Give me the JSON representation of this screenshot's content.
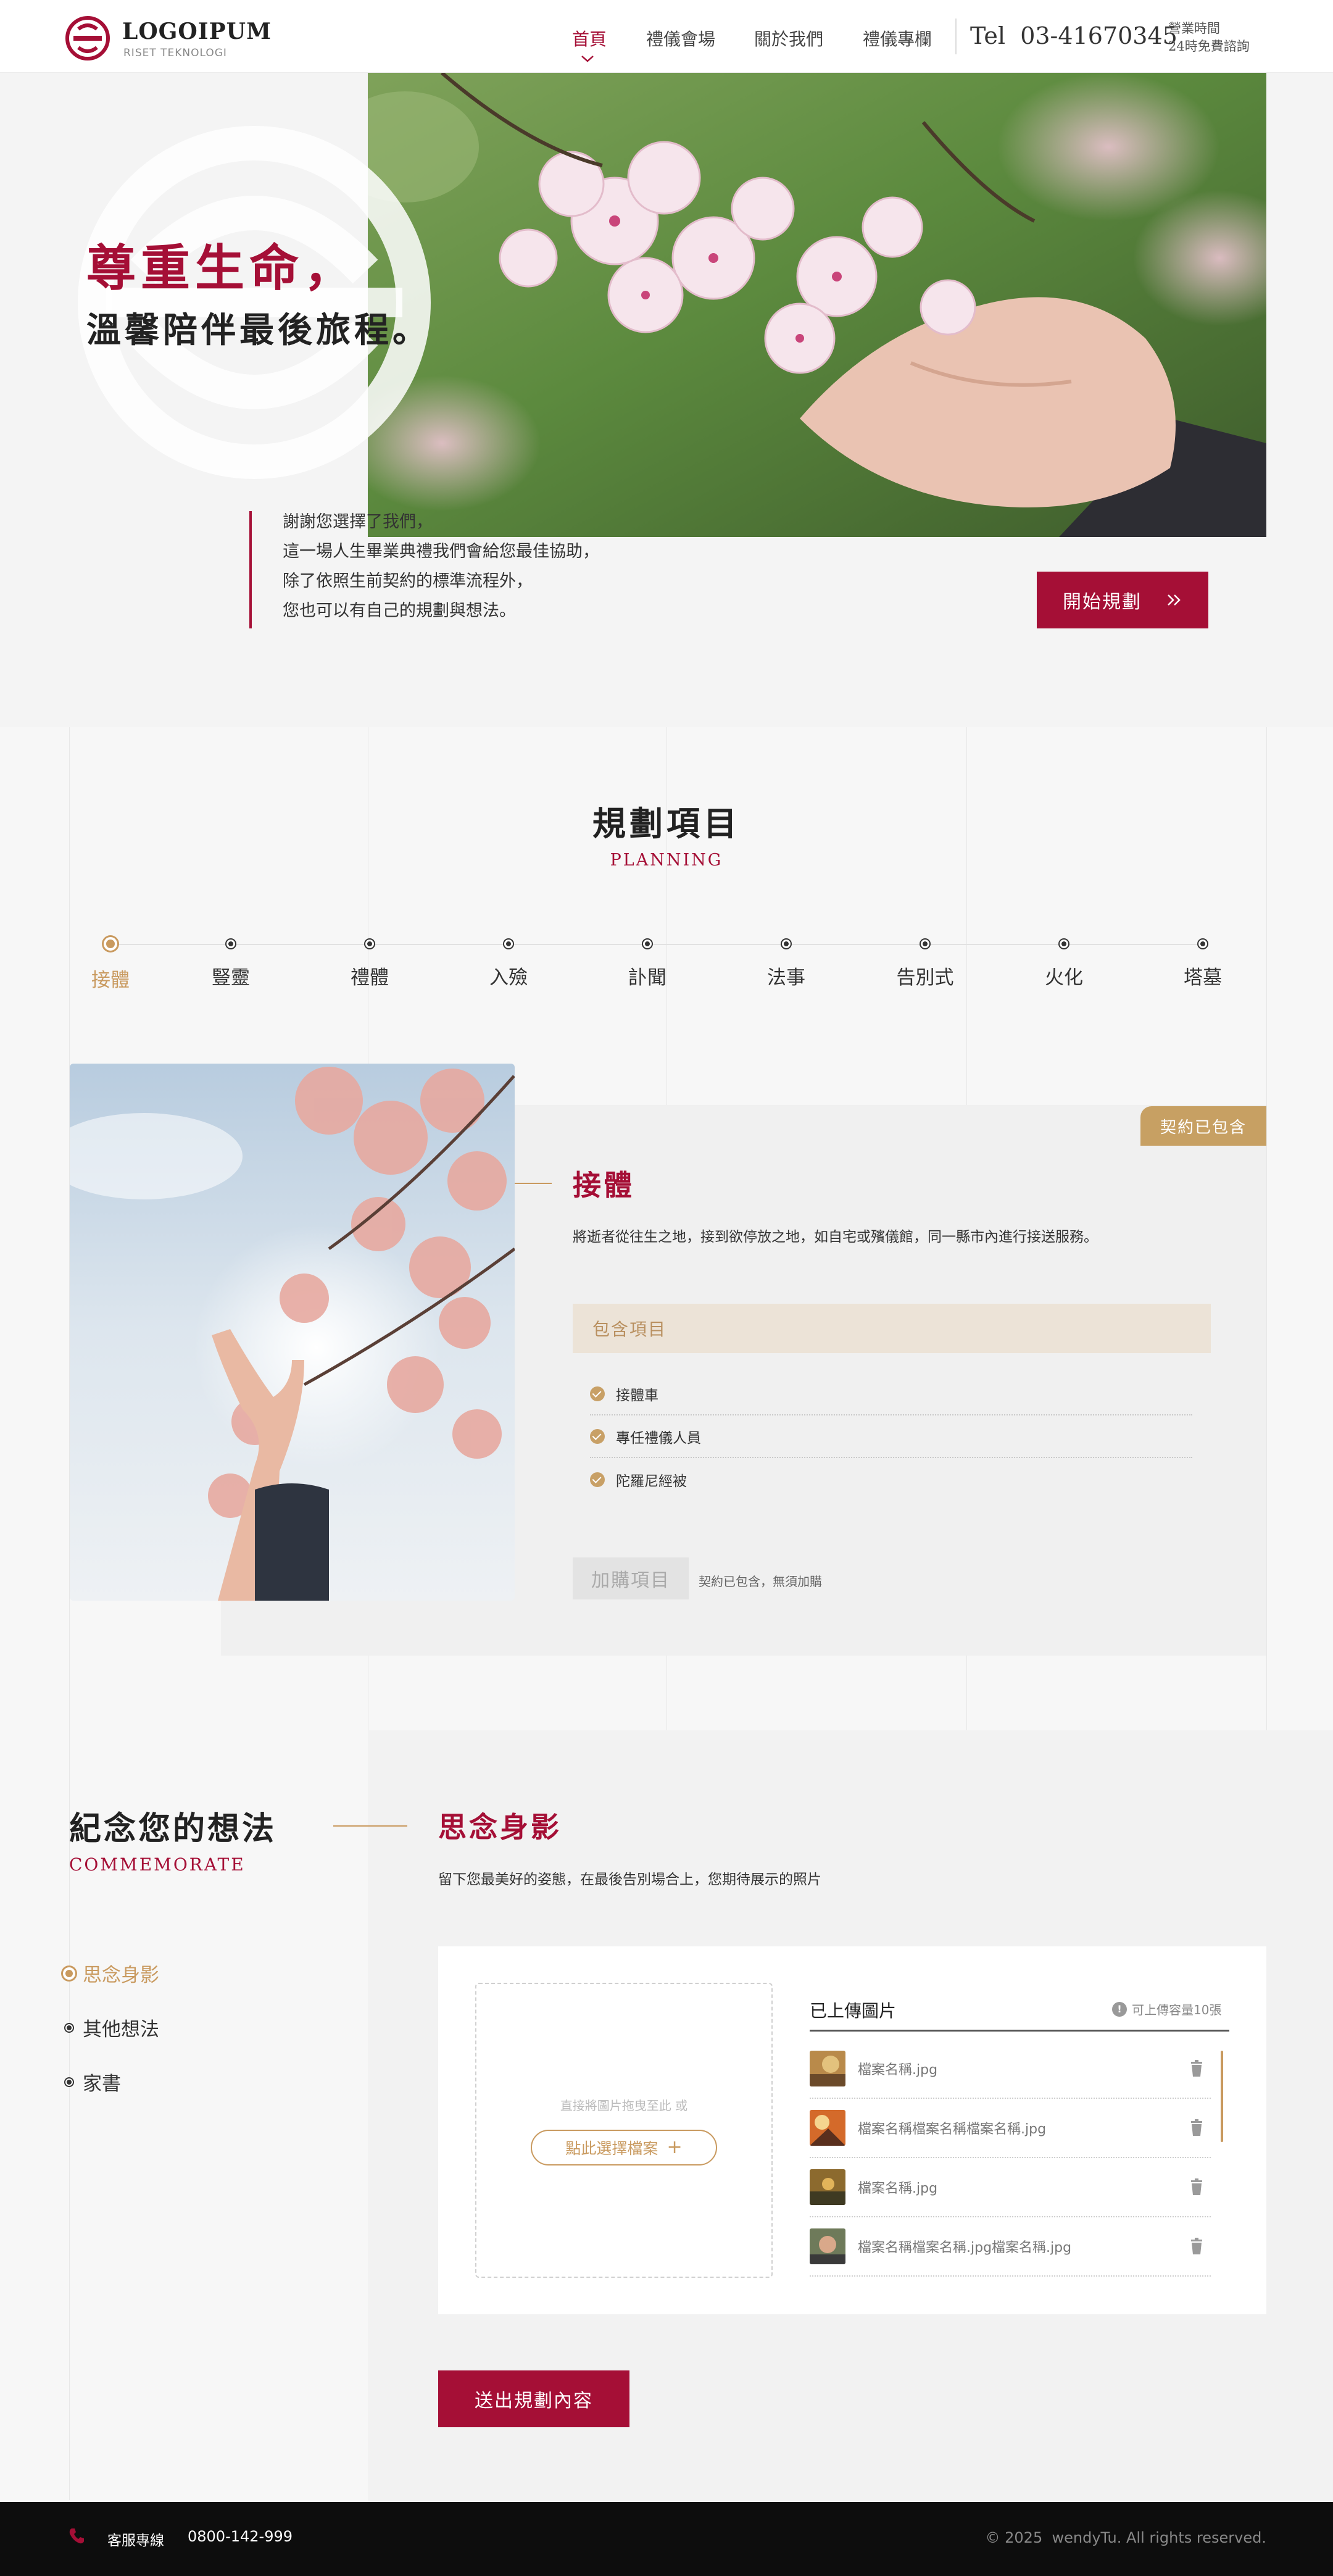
{
  "brand": {
    "name": "LOGOIPUM",
    "tagline": "RISET TEKNOLOGI"
  },
  "nav": {
    "items": [
      {
        "label": "首頁",
        "active": true
      },
      {
        "label": "禮儀會場",
        "active": false
      },
      {
        "label": "關於我們",
        "active": false
      },
      {
        "label": "禮儀專欄",
        "active": false
      }
    ],
    "tel": "Tel  03-41670345",
    "hours_line1": "營業時間",
    "hours_line2": "24時免費諮詢"
  },
  "hero": {
    "title_line1": "尊重生命，",
    "title_line2": "溫馨陪伴最後旅程。",
    "intro": [
      "謝謝您選擇了我們，",
      "這一場人生畢業典禮我們會給您最佳協助，",
      "除了依照生前契約的標準流程外，",
      "您也可以有自己的規劃與想法。"
    ],
    "cta_label": "開始規劃"
  },
  "planning": {
    "title": "規劃項目",
    "subtitle": "PLANNING",
    "steps": [
      "接體",
      "豎靈",
      "禮體",
      "入殮",
      "訃聞",
      "法事",
      "告別式",
      "火化",
      "塔墓"
    ],
    "active_index": 0
  },
  "detail": {
    "badge": "契約已包含",
    "title": "接體",
    "description": "將逝者從往生之地，接到欲停放之地，如自宅或殯儀館，同一縣市內進行接送服務。",
    "included_label": "包含項目",
    "included_items": [
      "接體車",
      "專任禮儀人員",
      "陀羅尼經被"
    ],
    "addon_label": "加購項目",
    "addon_note": "契約已包含，無須加購"
  },
  "commemorate": {
    "title": "紀念您的想法",
    "subtitle": "COMMEMORATE",
    "sidebar": [
      {
        "label": "思念身影",
        "active": true
      },
      {
        "label": "其他想法",
        "active": false
      },
      {
        "label": "家書",
        "active": false
      }
    ],
    "section_title": "思念身影",
    "section_desc": "留下您最美好的姿態，在最後告別場合上，您期待展示的照片",
    "drop_hint": "直接將圖片拖曳至此 或",
    "drop_button": "點此選擇檔案",
    "uploaded_title": "已上傳圖片",
    "capacity_note": "可上傳容量10張",
    "files": [
      {
        "name": "檔案名稱.jpg"
      },
      {
        "name": "檔案名稱檔案名稱檔案名稱.jpg"
      },
      {
        "name": "檔案名稱.jpg"
      },
      {
        "name": "檔案名稱檔案名稱.jpg檔案名稱.jpg"
      }
    ],
    "submit_label": "送出規劃內容"
  },
  "footer": {
    "service_label": "客服專線",
    "service_phone": "0800-142-999",
    "copyright": "© 2025  wendyTu. All rights reserved."
  },
  "colors": {
    "primary": "#a50f36",
    "accent": "#c99a5f",
    "footer_bg": "#0d0d0d"
  }
}
